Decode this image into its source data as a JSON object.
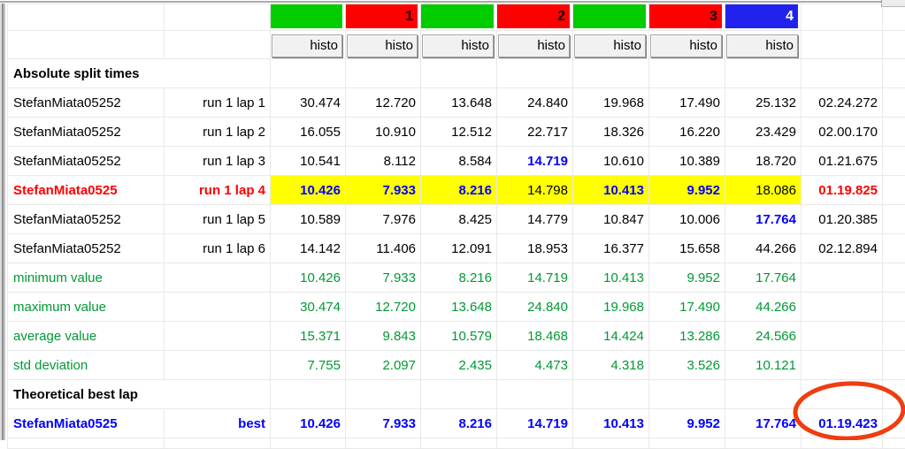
{
  "colors": {
    "channel_green": "#00cc00",
    "channel_red": "#ff0000",
    "channel_blue": "#2222ee",
    "highlight_yellow": "#ffff00",
    "best_value_blue": "#0000ff",
    "selected_lap_red": "#ff0000",
    "stat_green": "#009933",
    "annotation_red": "#ee3d0f"
  },
  "header": {
    "groups": [
      {
        "label": "",
        "color": "#00cc00",
        "text": "#000000"
      },
      {
        "label": "1",
        "color": "#ff0000",
        "text": "#000000"
      },
      {
        "label": "",
        "color": "#00cc00",
        "text": "#000000"
      },
      {
        "label": "2",
        "color": "#ff0000",
        "text": "#000000"
      },
      {
        "label": "",
        "color": "#00cc00",
        "text": "#000000"
      },
      {
        "label": "3",
        "color": "#ff0000",
        "text": "#000000"
      },
      {
        "label": "4",
        "color": "#2222ee",
        "text": "#ffffff"
      }
    ],
    "histo_label": "histo"
  },
  "rows": [
    {
      "type": "groups"
    },
    {
      "type": "histo"
    },
    {
      "type": "section",
      "label": "Absolute split times"
    },
    {
      "type": "lap",
      "name": "StefanMiata05252",
      "run": "run 1 lap 1",
      "values": [
        "30.474",
        "12.720",
        "13.648",
        "24.840",
        "19.968",
        "17.490",
        "25.132"
      ],
      "blue": [],
      "total": "02.24.272"
    },
    {
      "type": "lap",
      "name": "StefanMiata05252",
      "run": "run 1 lap 2",
      "values": [
        "16.055",
        "10.910",
        "12.512",
        "22.717",
        "18.326",
        "16.220",
        "23.429"
      ],
      "blue": [],
      "total": "02.00.170"
    },
    {
      "type": "lap",
      "name": "StefanMiata05252",
      "run": "run 1 lap 3",
      "values": [
        "10.541",
        "8.112",
        "8.584",
        "14.719",
        "10.610",
        "10.389",
        "18.720"
      ],
      "blue": [
        3
      ],
      "total": "01.21.675"
    },
    {
      "type": "lap",
      "highlight": true,
      "name": "StefanMiata0525",
      "run": "run 1 lap 4",
      "values": [
        "10.426",
        "7.933",
        "8.216",
        "14.798",
        "10.413",
        "9.952",
        "18.086"
      ],
      "blue": [
        0,
        1,
        2,
        4,
        5
      ],
      "total": "01.19.825"
    },
    {
      "type": "lap",
      "name": "StefanMiata05252",
      "run": "run 1 lap 5",
      "values": [
        "10.589",
        "7.976",
        "8.425",
        "14.779",
        "10.847",
        "10.006",
        "17.764"
      ],
      "blue": [
        6
      ],
      "total": "01.20.385"
    },
    {
      "type": "lap",
      "name": "StefanMiata05252",
      "run": "run 1 lap 6",
      "values": [
        "14.142",
        "11.406",
        "12.091",
        "18.953",
        "16.377",
        "15.658",
        "44.266"
      ],
      "blue": [],
      "total": "02.12.894"
    },
    {
      "type": "stat",
      "label": "minimum value",
      "values": [
        "10.426",
        "7.933",
        "8.216",
        "14.719",
        "10.413",
        "9.952",
        "17.764"
      ]
    },
    {
      "type": "stat",
      "label": "maximum value",
      "values": [
        "30.474",
        "12.720",
        "13.648",
        "24.840",
        "19.968",
        "17.490",
        "44.266"
      ]
    },
    {
      "type": "stat",
      "label": "average value",
      "values": [
        "15.371",
        "9.843",
        "10.579",
        "18.468",
        "14.424",
        "13.286",
        "24.566"
      ]
    },
    {
      "type": "stat",
      "label": "std deviation",
      "values": [
        "7.755",
        "2.097",
        "2.435",
        "4.473",
        "4.318",
        "3.526",
        "10.121"
      ]
    },
    {
      "type": "section",
      "label": "Theoretical best lap"
    },
    {
      "type": "best",
      "name": "StefanMiata0525",
      "run": "best",
      "values": [
        "10.426",
        "7.933",
        "8.216",
        "14.719",
        "10.413",
        "9.952",
        "17.764"
      ],
      "total": "01.19.423"
    },
    {
      "type": "empty"
    }
  ],
  "annotation": {
    "shape": "ellipse",
    "around": "01.19.423"
  }
}
